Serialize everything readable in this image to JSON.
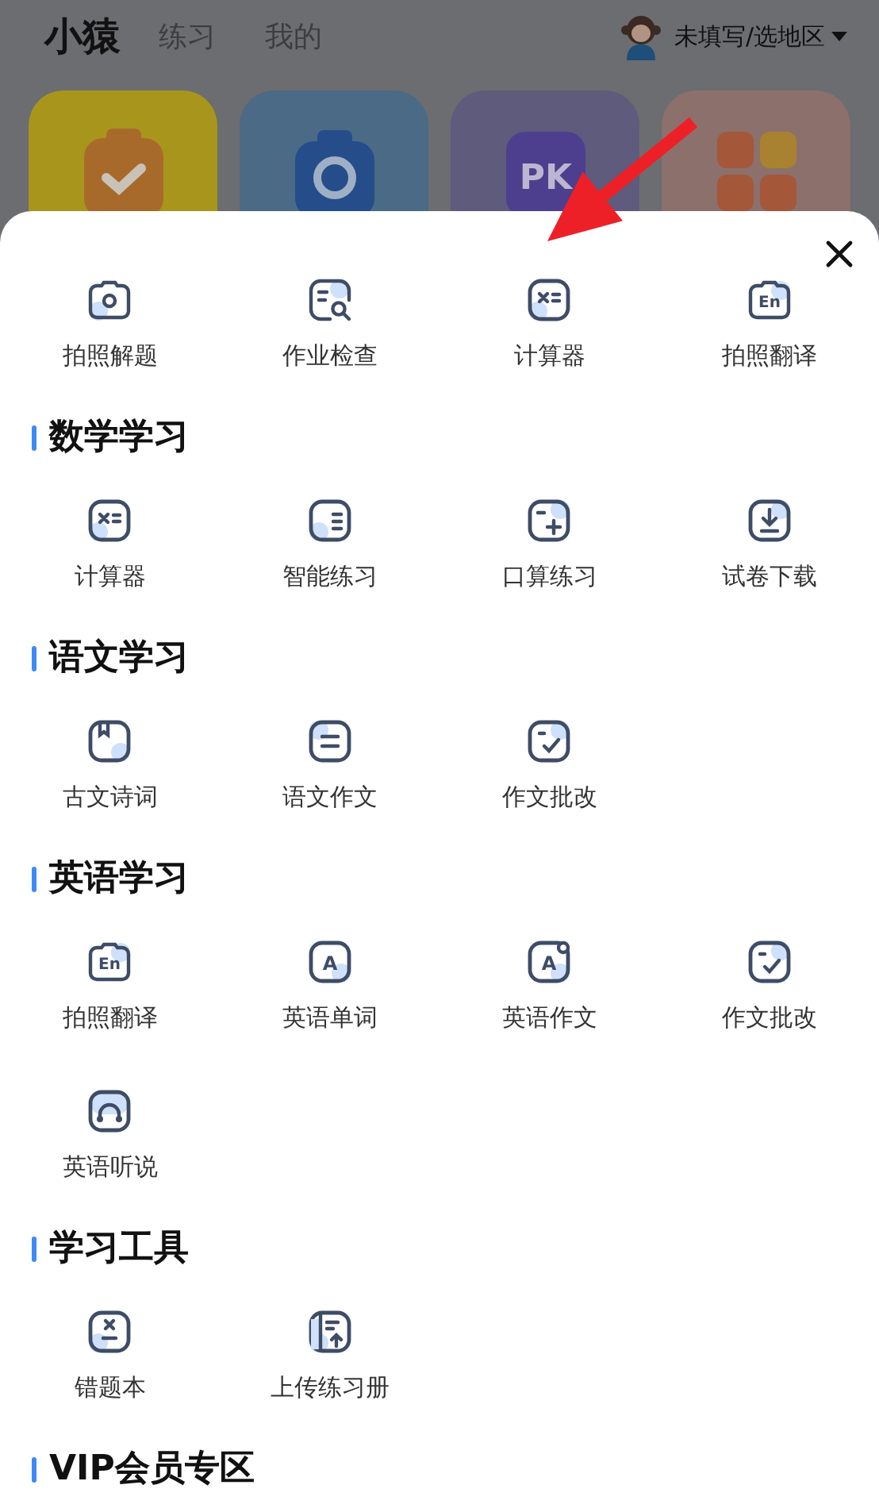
{
  "header": {
    "tabs": [
      {
        "label": "小猿",
        "selected": true
      },
      {
        "label": "练习",
        "selected": false
      },
      {
        "label": "我的",
        "selected": false
      }
    ],
    "region": "未填写/选地区"
  },
  "tiles": [
    {
      "color": "#a8951c"
    },
    {
      "color": "#4a6a86"
    },
    {
      "color": "#5e5b7c",
      "glyph": "PK"
    },
    {
      "color": "#8c706b"
    }
  ],
  "sheet": {
    "quick_tools": [
      {
        "label": "拍照解题"
      },
      {
        "label": "作业检查"
      },
      {
        "label": "计算器"
      },
      {
        "label": "拍照翻译",
        "glyph": "En"
      }
    ],
    "sections": [
      {
        "title": "数学学习",
        "items": [
          {
            "label": "计算器"
          },
          {
            "label": "智能练习"
          },
          {
            "label": "口算练习"
          },
          {
            "label": "试卷下载"
          }
        ]
      },
      {
        "title": "语文学习",
        "items": [
          {
            "label": "古文诗词"
          },
          {
            "label": "语文作文"
          },
          {
            "label": "作文批改"
          }
        ]
      },
      {
        "title": "英语学习",
        "items": [
          {
            "label": "拍照翻译",
            "glyph": "En"
          },
          {
            "label": "英语单词",
            "glyph": "A"
          },
          {
            "label": "英语作文",
            "glyph": "A"
          },
          {
            "label": "作文批改"
          },
          {
            "label": "英语听说"
          }
        ]
      },
      {
        "title": "学习工具",
        "items": [
          {
            "label": "错题本"
          },
          {
            "label": "上传练习册"
          }
        ]
      },
      {
        "title": "VIP会员专区"
      }
    ]
  }
}
